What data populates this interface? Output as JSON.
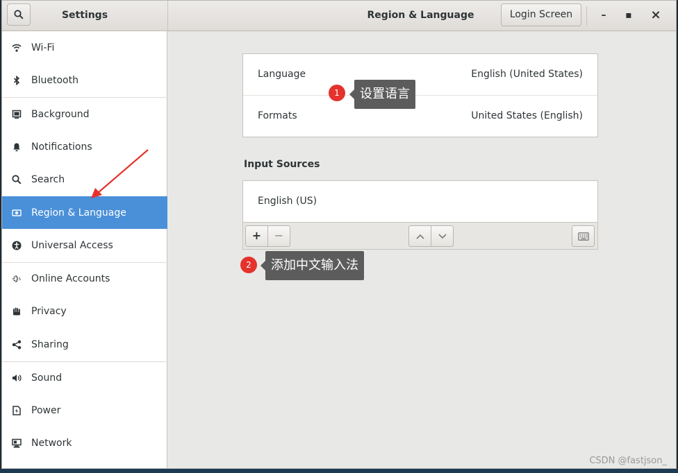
{
  "header": {
    "settings_title": "Settings",
    "page_title": "Region & Language",
    "login_screen_label": "Login Screen",
    "minimize_glyph": "–",
    "maximize_glyph": "▪",
    "close_glyph": "×"
  },
  "sidebar": {
    "items": [
      {
        "label": "Wi-Fi",
        "icon": "wifi-icon"
      },
      {
        "label": "Bluetooth",
        "icon": "bluetooth-icon"
      },
      {
        "label": "Background",
        "icon": "background-icon"
      },
      {
        "label": "Notifications",
        "icon": "bell-icon"
      },
      {
        "label": "Search",
        "icon": "search-icon"
      },
      {
        "label": "Region & Language",
        "icon": "region-icon",
        "active": true
      },
      {
        "label": "Universal Access",
        "icon": "accessibility-icon"
      },
      {
        "label": "Online Accounts",
        "icon": "online-accounts-icon"
      },
      {
        "label": "Privacy",
        "icon": "privacy-hand-icon"
      },
      {
        "label": "Sharing",
        "icon": "share-icon"
      },
      {
        "label": "Sound",
        "icon": "speaker-icon"
      },
      {
        "label": "Power",
        "icon": "power-icon"
      },
      {
        "label": "Network",
        "icon": "network-icon"
      }
    ]
  },
  "main": {
    "language_label": "Language",
    "language_value": "English (United States)",
    "formats_label": "Formats",
    "formats_value": "United States (English)",
    "input_sources_title": "Input Sources",
    "input_sources": [
      "English (US)"
    ],
    "add_glyph": "+",
    "remove_glyph": "−"
  },
  "annotations": {
    "one_number": "1",
    "one_text": "设置语言",
    "two_number": "2",
    "two_text": "添加中文输入法"
  },
  "watermark": "CSDN @fastjson_",
  "colors": {
    "accent": "#4a90d9",
    "badge": "#e5322d",
    "arrow": "#e5322d"
  }
}
